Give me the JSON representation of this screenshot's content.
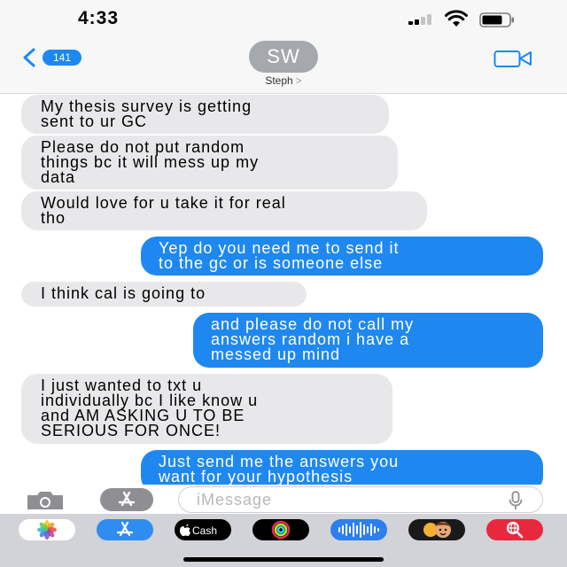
{
  "status_bar": {
    "time": "4:33"
  },
  "header": {
    "back_count": "141",
    "avatar_initials": "SW",
    "contact_name": "Steph",
    "contact_chevron": ">"
  },
  "messages": [
    {
      "direction": "incoming",
      "text": "My thesis survey is getting\nsent to ur GC"
    },
    {
      "direction": "incoming",
      "text": "Please do not put random\nthings bc it will mess up my\ndata"
    },
    {
      "direction": "incoming",
      "text": "Would love for u take it for real\ntho"
    },
    {
      "direction": "outgoing",
      "text": "Yep do you need me to send it\nto the gc or is someone else"
    },
    {
      "direction": "incoming",
      "text": "I think cal is going to"
    },
    {
      "direction": "outgoing",
      "text": "and please do not call my\nanswers random i have a\nmessed up mind"
    },
    {
      "direction": "incoming",
      "text": "I just wanted to txt u\nindividually bc I like know u\nand AM ASKING U TO BE\nSERIOUS FOR ONCE!"
    },
    {
      "direction": "outgoing",
      "text": "Just send me the answers you\nwant for your hypothesis"
    }
  ],
  "compose": {
    "placeholder": "iMessage"
  },
  "app_drawer": {
    "apps": [
      {
        "name": "Photos",
        "icon": "photos-icon"
      },
      {
        "name": "App Store",
        "icon": "app-store-icon"
      },
      {
        "name": "Cash",
        "icon": "apple-cash-icon"
      },
      {
        "name": "Activity",
        "icon": "activity-icon"
      },
      {
        "name": "Audio",
        "icon": "audio-message-icon"
      },
      {
        "name": "Memoji",
        "icon": "memoji-icon"
      },
      {
        "name": "Search",
        "icon": "web-search-icon"
      }
    ]
  },
  "colors": {
    "incoming_bubble": "#e8e8ea",
    "outgoing_bubble": "#1f88f0",
    "accent": "#1e88f2"
  }
}
